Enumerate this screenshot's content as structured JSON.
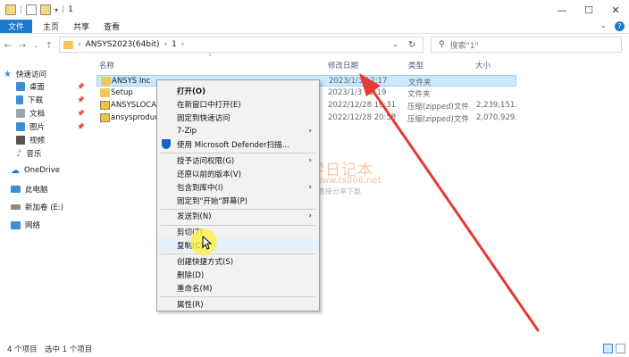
{
  "titlebar": {
    "title": "1",
    "minimize": "—",
    "maximize": "☐",
    "close": "✕",
    "help": "?"
  },
  "ribbon": {
    "tabs": [
      "文件",
      "主页",
      "共享",
      "查看"
    ]
  },
  "address": {
    "path": [
      "ANSYS2023(64bit)",
      "1"
    ],
    "separator": "›",
    "refresh": "↻",
    "dropdown": "⌄"
  },
  "search": {
    "placeholder": "搜索\"1\""
  },
  "nav": {
    "quick_access": "快速访问",
    "items": [
      {
        "label": "桌面",
        "pinned": true,
        "color": "#3c8ed8"
      },
      {
        "label": "下载",
        "pinned": true,
        "color": "#3c8ed8"
      },
      {
        "label": "文档",
        "pinned": true,
        "color": "#9aa6b2"
      },
      {
        "label": "图片",
        "pinned": true,
        "color": "#3c8ed8"
      },
      {
        "label": "视频",
        "pinned": false,
        "color": "#555"
      },
      {
        "label": "音乐",
        "pinned": false,
        "color": "#3c8ed8"
      }
    ],
    "onedrive": "OneDrive",
    "this_pc": "此电脑",
    "drive": "新加卷 (E:)",
    "network": "网络"
  },
  "columns": {
    "name": "名称",
    "date": "修改日期",
    "type": "类型",
    "size": "大小"
  },
  "files": [
    {
      "name": "ANSYS Inc",
      "date": "2023/1/3 12:17",
      "type": "文件夹",
      "size": "",
      "selected": true,
      "kind": "folder"
    },
    {
      "name": "Setup",
      "date": "2023/1/3 12:19",
      "type": "文件夹",
      "size": "",
      "selected": false,
      "kind": "folder"
    },
    {
      "name": "ANSYSLOCALH",
      "date": "2022/12/28 19:31",
      "type": "压缩(zipped)文件...",
      "size": "2,239,151...",
      "selected": false,
      "kind": "zip"
    },
    {
      "name": "ansysproductp",
      "date": "2022/12/28 20:58",
      "type": "压缩(zipped)文件...",
      "size": "2,070,929...",
      "selected": false,
      "kind": "zip"
    }
  ],
  "menu": {
    "items": [
      {
        "label": "打开(O)",
        "bold": true
      },
      {
        "label": "在新窗口中打开(E)"
      },
      {
        "label": "固定到快速访问"
      },
      {
        "label": "7-Zip",
        "submenu": true
      },
      {
        "label": "使用 Microsoft Defender扫描...",
        "icon": "shield"
      },
      {
        "label": "授予访问权限(G)",
        "submenu": true
      },
      {
        "label": "还原以前的版本(V)"
      },
      {
        "label": "包含到库中(I)",
        "submenu": true
      },
      {
        "label": "固定到\"开始\"屏幕(P)"
      },
      {
        "label": "发送到(N)",
        "submenu": true
      },
      {
        "label": "剪切(T)"
      },
      {
        "label": "复制(C)",
        "highlight": true
      },
      {
        "label": "创建快捷方式(S)"
      },
      {
        "label": "删除(D)"
      },
      {
        "label": "重命名(M)"
      },
      {
        "label": "属性(R)"
      }
    ]
  },
  "status": {
    "count": "4 个项目",
    "selected": "选中 1 个项目"
  },
  "watermark": {
    "title": "丁同学日记本",
    "url": "www.ts006.net",
    "tagline": "软件、资源、资料等应直接分享下载"
  },
  "colors": {
    "accent": "#1979ca",
    "selection": "#cce8ff",
    "arrow": "#e53935",
    "folder": "#f3c75a"
  }
}
